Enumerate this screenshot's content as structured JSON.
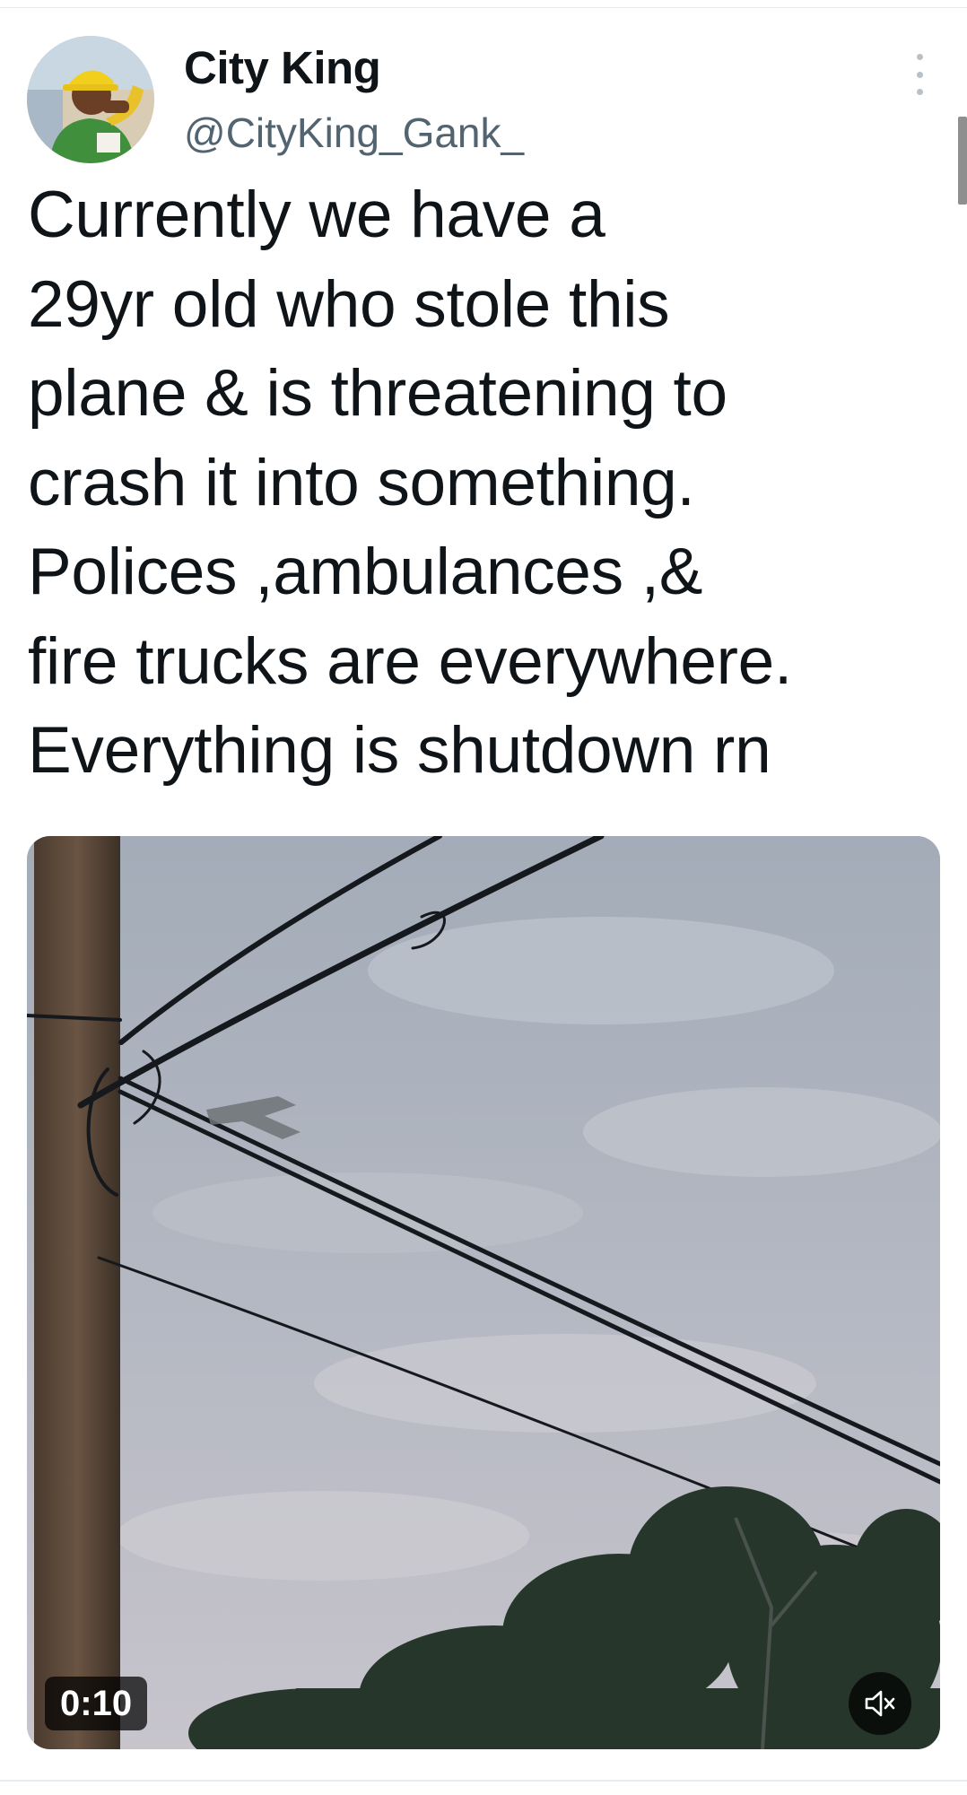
{
  "tweet": {
    "author": {
      "display_name": "City King",
      "handle": "@CityKing_Gank_"
    },
    "text_lines": [
      "Currently we have a",
      "29yr old who stole this",
      "plane & is threatening to",
      "crash it into something.",
      "Polices ,ambulances ,&",
      "fire trucks are everywhere.",
      "Everything is shutdown rn"
    ],
    "media": {
      "type": "video",
      "duration": "0:10",
      "muted": true
    },
    "icons": {
      "more": "more-options-icon",
      "mute": "speaker-muted-icon"
    }
  },
  "colors": {
    "text": "#0f1419",
    "secondary_text": "#536471",
    "divider": "#e6ecf0"
  }
}
